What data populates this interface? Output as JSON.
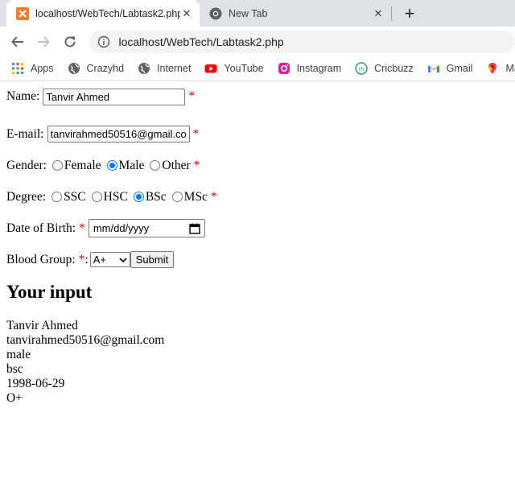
{
  "browser": {
    "tabs": [
      {
        "title": "localhost/WebTech/Labtask2.php",
        "icon": "xampp-icon"
      },
      {
        "title": "New Tab",
        "icon": "chrome-icon"
      }
    ],
    "address": "localhost/WebTech/Labtask2.php",
    "bookmarks": [
      {
        "label": "Apps",
        "icon": "apps-grid-icon"
      },
      {
        "label": "Crazyhd",
        "icon": "globe-icon"
      },
      {
        "label": "Internet",
        "icon": "globe-icon"
      },
      {
        "label": "YouTube",
        "icon": "youtube-icon"
      },
      {
        "label": "Instagram",
        "icon": "instagram-icon"
      },
      {
        "label": "Cricbuzz",
        "icon": "cricbuzz-icon"
      },
      {
        "label": "Gmail",
        "icon": "gmail-icon"
      },
      {
        "label": "Maps",
        "icon": "maps-icon"
      }
    ]
  },
  "form": {
    "name_label": "Name:",
    "name_value": "Tanvir Ahmed",
    "email_label": "E-mail:",
    "email_value": "tanvirahmed50516@gmail.com",
    "gender_label": "Gender:",
    "gender_options": [
      "Female",
      "Male",
      "Other"
    ],
    "gender_selected": "Male",
    "degree_label": "Degree:",
    "degree_options": [
      "SSC",
      "HSC",
      "BSc",
      "MSc"
    ],
    "degree_selected": "BSc",
    "dob_label": "Date of Birth:",
    "dob_placeholder": "mm/dd/yyyy",
    "blood_label": "Blood Group:",
    "blood_sep": ":",
    "blood_value": "A+",
    "submit_label": "Submit",
    "required_mark": "*"
  },
  "output": {
    "heading": "Your input",
    "lines": [
      "Tanvir Ahmed",
      "tanvirahmed50516@gmail.com",
      "male",
      "bsc",
      "1998-06-29",
      "O+"
    ]
  },
  "colors": {
    "required": "#e00000",
    "accent": "#0075ff"
  }
}
